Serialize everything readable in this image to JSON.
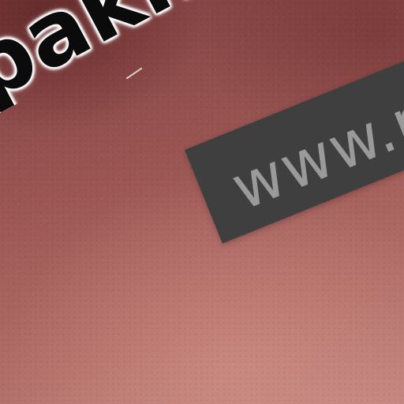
{
  "wall_lettering": {
    "text": "pakn"
  },
  "banner": {
    "url_text": "www.p"
  }
}
